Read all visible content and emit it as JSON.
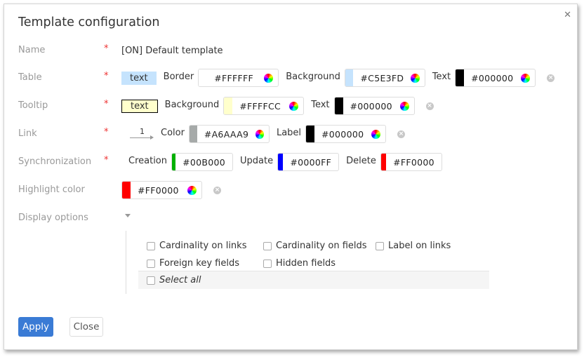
{
  "dialog": {
    "title": "Template configuration",
    "close_icon": "close-icon"
  },
  "required_mark": "*",
  "rows": {
    "name": {
      "label": "Name",
      "value": "[ON] Default template"
    },
    "table": {
      "label": "Table",
      "sample_text": "text",
      "border": {
        "label": "Border",
        "hex": "#FFFFFF",
        "color": "#FFFFFF"
      },
      "background": {
        "label": "Background",
        "hex": "#C5E3FD",
        "color": "#C5E3FD"
      },
      "text": {
        "label": "Text",
        "hex": "#000000",
        "color": "#000000"
      }
    },
    "tooltip": {
      "label": "Tooltip",
      "sample_text": "text",
      "background": {
        "label": "Background",
        "hex": "#FFFFCC",
        "color": "#FFFFCC"
      },
      "text": {
        "label": "Text",
        "hex": "#000000",
        "color": "#000000"
      }
    },
    "link": {
      "label": "Link",
      "sample_number": "1",
      "color": {
        "label": "Color",
        "hex": "#A6AAA9",
        "color": "#A6AAA9"
      },
      "label_color": {
        "label": "Label",
        "hex": "#000000",
        "color": "#000000"
      }
    },
    "synchronization": {
      "label": "Synchronization",
      "creation": {
        "label": "Creation",
        "hex": "#00B000",
        "color": "#00B000"
      },
      "update": {
        "label": "Update",
        "hex": "#0000FF",
        "color": "#0000FF"
      },
      "delete": {
        "label": "Delete",
        "hex": "#FF0000",
        "color": "#FF0000"
      }
    },
    "highlight": {
      "label": "Highlight color",
      "hex": "#FF0000",
      "color": "#FF0000"
    },
    "display_options": {
      "label": "Display options",
      "options": [
        {
          "label": "Cardinality on links",
          "checked": false
        },
        {
          "label": "Cardinality on fields",
          "checked": false
        },
        {
          "label": "Label on links",
          "checked": false
        },
        {
          "label": "Foreign key fields",
          "checked": false
        },
        {
          "label": "Hidden fields",
          "checked": false
        }
      ],
      "select_all": {
        "label": "Select all",
        "checked": false
      }
    }
  },
  "buttons": {
    "apply": "Apply",
    "close": "Close"
  },
  "colors": {
    "accent": "#3A7BD5",
    "required": "#EE3333"
  }
}
